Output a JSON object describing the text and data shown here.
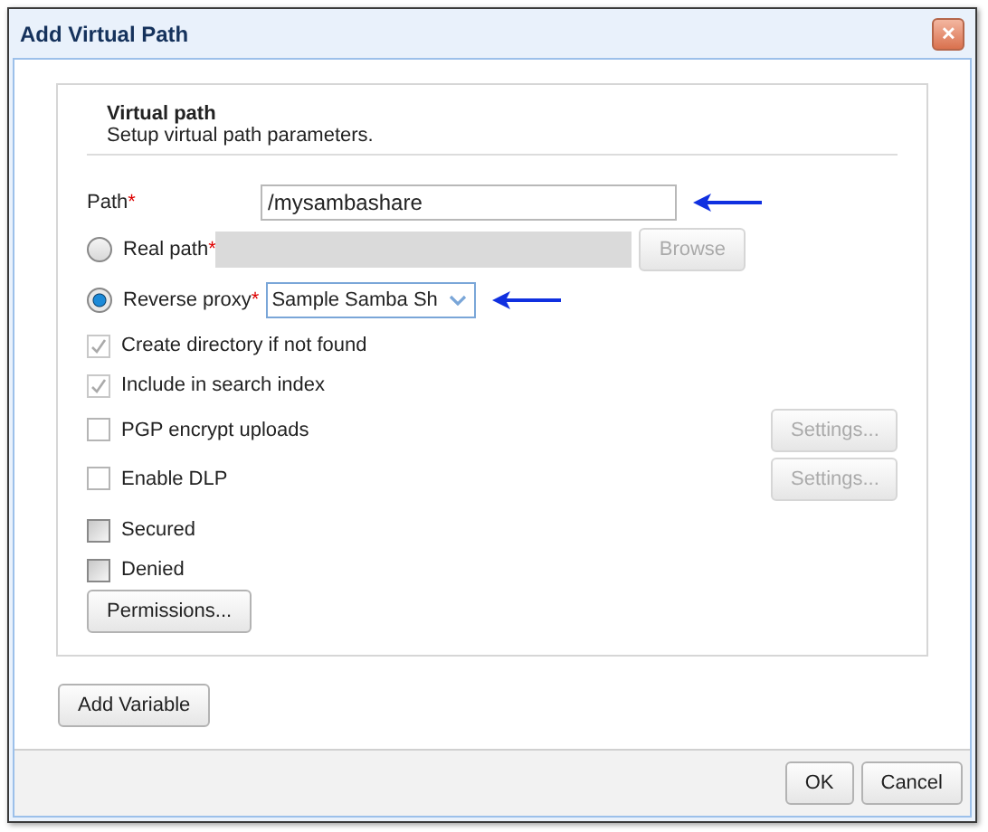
{
  "window": {
    "title": "Add Virtual Path",
    "close": "✕"
  },
  "section": {
    "title": "Virtual path",
    "subtitle": "Setup virtual path parameters."
  },
  "path": {
    "label": "Path",
    "required": "*",
    "value": "/mysambashare",
    "annotated": true
  },
  "sources": [
    {
      "kind": "field",
      "label": "Real path",
      "required": "*",
      "selected": false,
      "button": "Browse",
      "disabled": true,
      "annotated": false
    },
    {
      "kind": "select",
      "label": "Reverse proxy",
      "required": "*",
      "selected": true,
      "value": "Sample Samba Sh",
      "annotated": true
    }
  ],
  "options": [
    {
      "kind": "plain",
      "label": "Create directory if not found",
      "checked": true,
      "disabled": true
    },
    {
      "kind": "plain",
      "label": "Include in search index",
      "checked": true,
      "disabled": true
    },
    {
      "kind": "settings",
      "label": "PGP encrypt uploads",
      "checked": false,
      "disabled": false,
      "button": "Settings...",
      "button_disabled": true
    },
    {
      "kind": "settings",
      "label": "Enable DLP",
      "checked": false,
      "disabled": false,
      "button": "Settings...",
      "button_disabled": true
    },
    {
      "kind": "shaded",
      "label": "Secured",
      "checked": false,
      "disabled": false
    },
    {
      "kind": "shaded",
      "label": "Denied",
      "checked": false,
      "disabled": false
    }
  ],
  "permissions_button": "Permissions...",
  "add_variable_button": "Add Variable",
  "footer_buttons": [
    "OK",
    "Cancel"
  ]
}
